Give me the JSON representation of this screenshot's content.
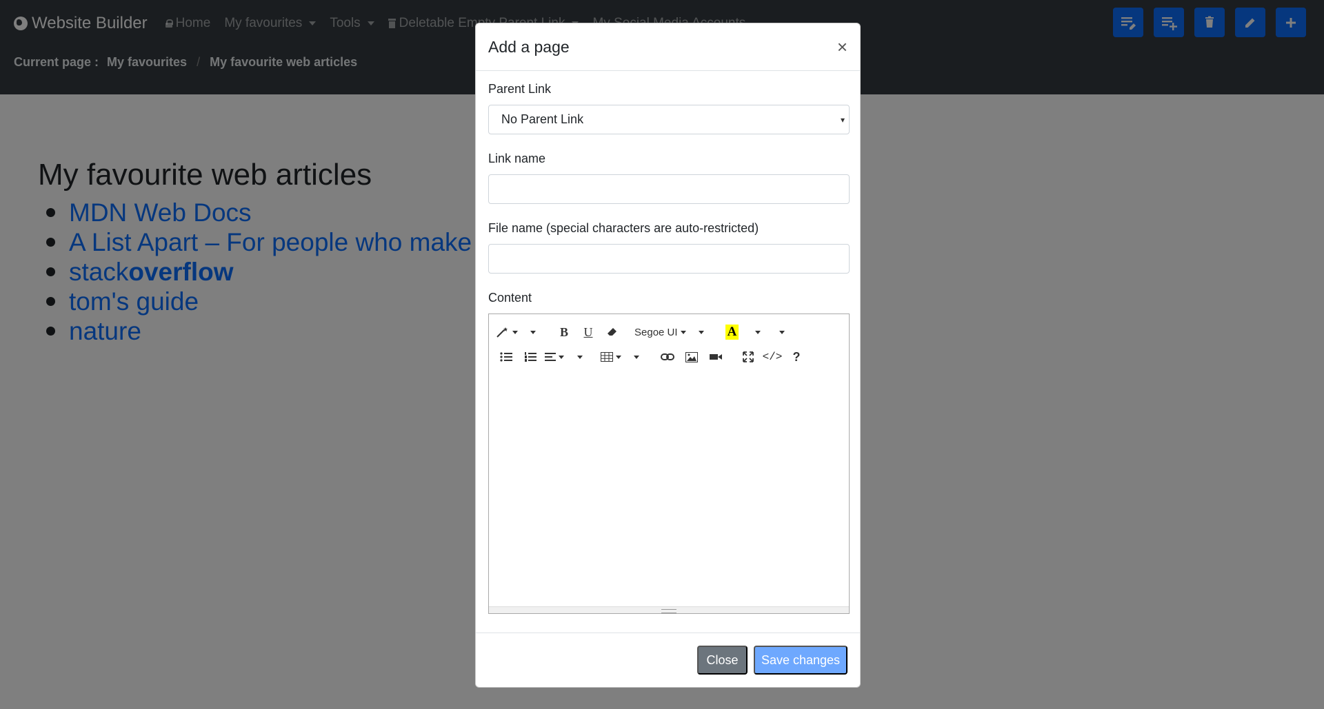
{
  "navbar": {
    "brand": "Website Builder",
    "items": [
      {
        "label": "Home",
        "icon": "lock-icon"
      },
      {
        "label": "My favourites",
        "dropdown": true
      },
      {
        "label": "Tools",
        "dropdown": true
      },
      {
        "label": "Deletable Empty Parent Link",
        "icon": "trash-icon",
        "dropdown": true
      },
      {
        "label": "My Social Media Accounts"
      }
    ],
    "breadcrumb": {
      "prefix": "Current page :",
      "items": [
        "My favourites",
        "My favourite web articles"
      ]
    },
    "toolbar_buttons": [
      "edit-content-icon",
      "add-list-icon",
      "delete-icon",
      "pencil-icon",
      "plus-icon"
    ],
    "accent_color": "#0d6efd"
  },
  "page": {
    "title": "My favourite web articles",
    "links": [
      {
        "text": "MDN Web Docs"
      },
      {
        "text": "A List Apart – For people who make websites"
      },
      {
        "text_a": "stack",
        "text_b": "overflow"
      },
      {
        "text": "tom's guide"
      },
      {
        "text": "nature"
      }
    ]
  },
  "modal": {
    "title": "Add a page",
    "close_glyph": "×",
    "parent_link": {
      "label": "Parent Link",
      "selected": "No Parent Link"
    },
    "link_name": {
      "label": "Link name",
      "value": ""
    },
    "file_name": {
      "label": "File name (special characters are auto-restricted)",
      "value": ""
    },
    "content": {
      "label": "Content",
      "font": "Segoe UI"
    },
    "buttons": {
      "close": "Close",
      "save": "Save changes"
    }
  }
}
